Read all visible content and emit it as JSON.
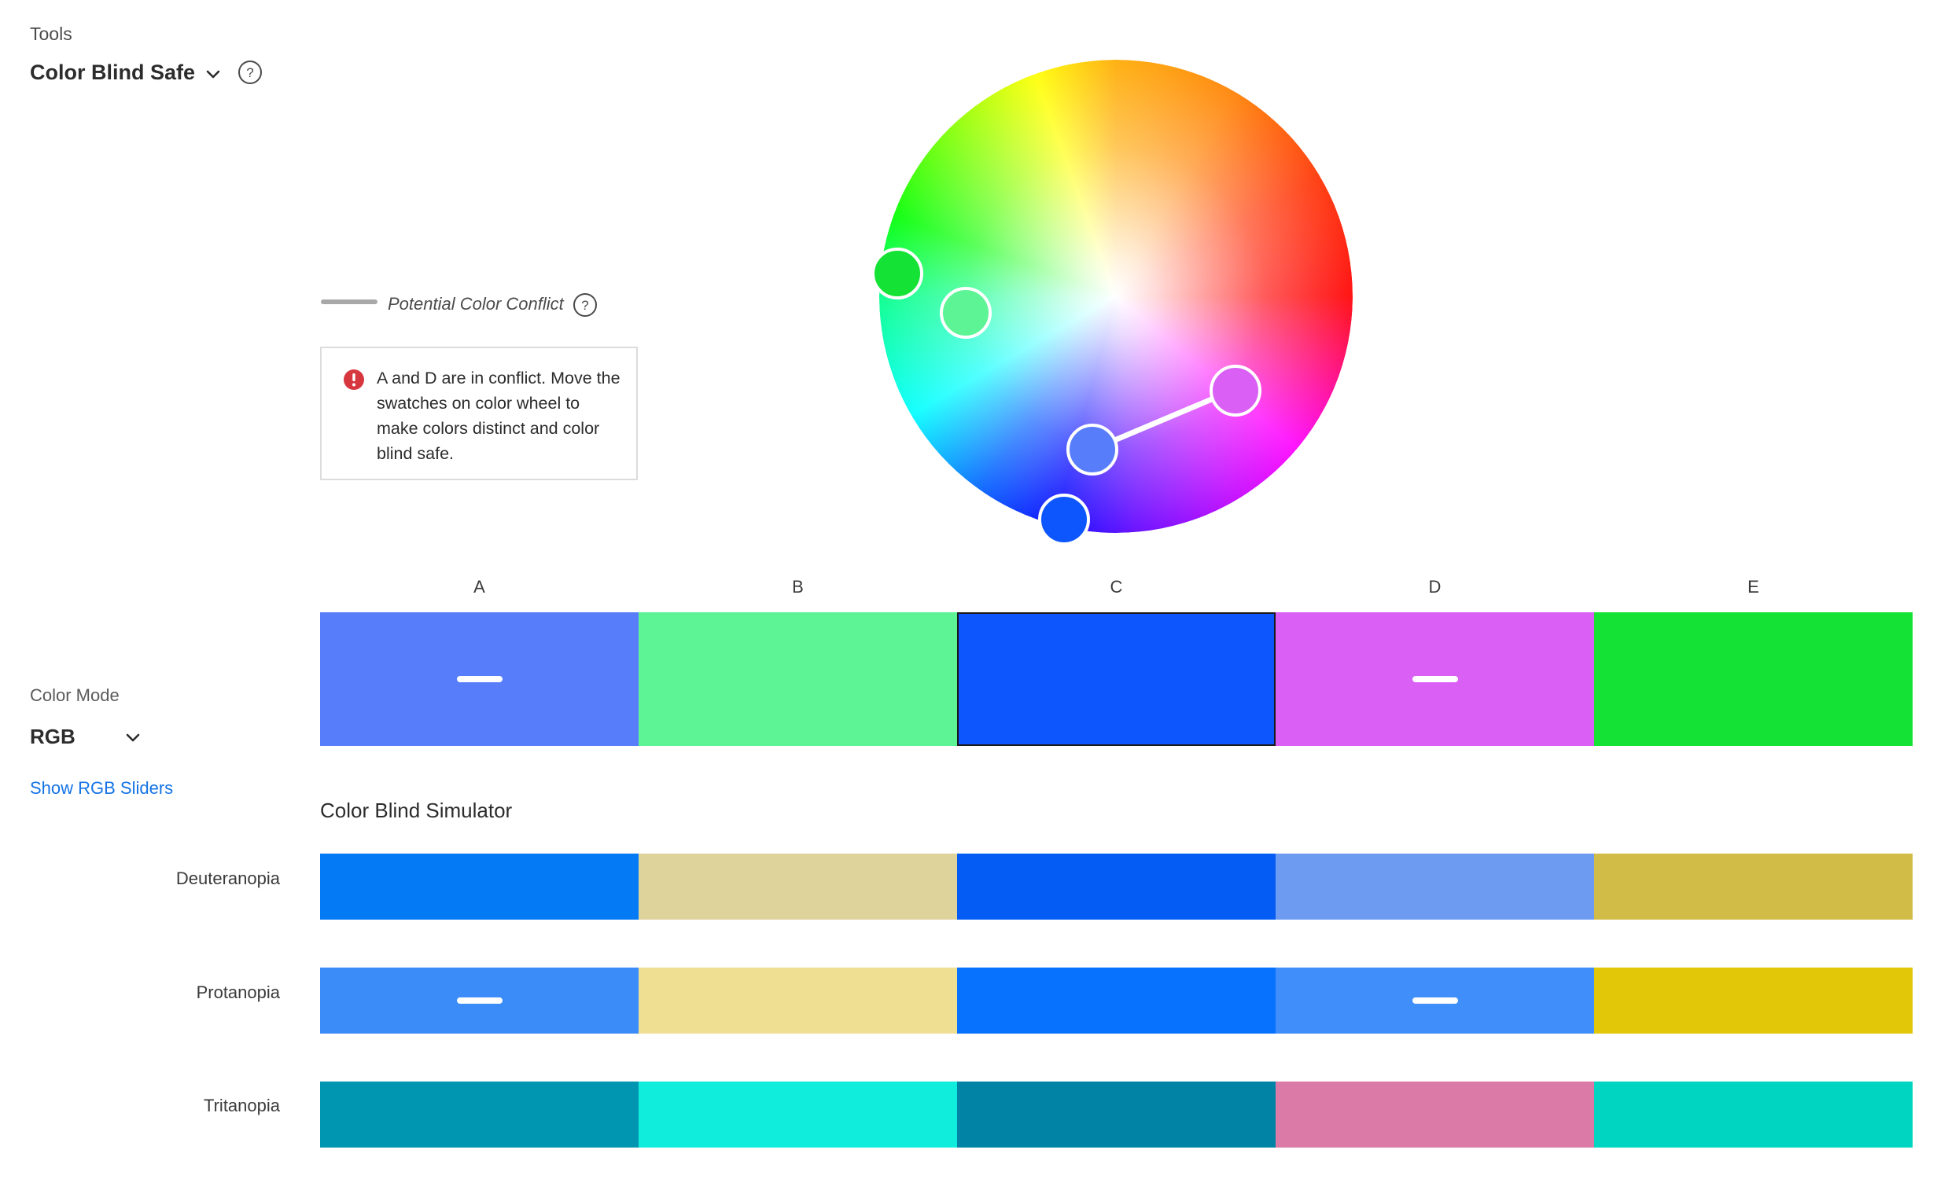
{
  "tool": {
    "section_label": "Tools",
    "title": "Color Blind Safe",
    "chevron_icon": "chevron-down-icon",
    "help_icon": "help-circle-icon"
  },
  "color_mode": {
    "label": "Color Mode",
    "value": "RGB",
    "chevron_icon": "chevron-down-icon",
    "sliders_link": "Show RGB Sliders"
  },
  "conflict_legend": {
    "text": "Potential Color Conflict",
    "help_icon": "help-circle-icon"
  },
  "warning": {
    "icon": "error-icon",
    "icon_color": "#d7373f",
    "text": "A and D are in conflict. Move the swatches on color wheel to make colors distinct and color blind safe."
  },
  "swatches": [
    {
      "label": "A",
      "color": "#587dfa",
      "conflict": true,
      "selected": false
    },
    {
      "label": "B",
      "color": "#5cf495",
      "conflict": false,
      "selected": false
    },
    {
      "label": "C",
      "color": "#0d55fc",
      "conflict": false,
      "selected": true
    },
    {
      "label": "D",
      "color": "#d95ff5",
      "conflict": true,
      "selected": false
    },
    {
      "label": "E",
      "color": "#14e234",
      "conflict": false,
      "selected": false
    }
  ],
  "simulator": {
    "title": "Color Blind Simulator",
    "rows": [
      {
        "name": "Deuteranopia",
        "colors": [
          "#047af5",
          "#dfd39c",
          "#045cf5",
          "#6e9bf2",
          "#d1bc48"
        ],
        "conflict": [
          false,
          false,
          false,
          false,
          false
        ]
      },
      {
        "name": "Protanopia",
        "colors": [
          "#3b8cf9",
          "#efdf92",
          "#0672fd",
          "#3f8ef9",
          "#e1c707"
        ],
        "conflict": [
          true,
          false,
          false,
          true,
          false
        ]
      },
      {
        "name": "Tritanopia",
        "colors": [
          "#0096b2",
          "#10eddd",
          "#0083a5",
          "#dc7aa7",
          "#00d5c1"
        ],
        "conflict": [
          false,
          false,
          false,
          false,
          false
        ]
      }
    ]
  },
  "wheel_handles": [
    {
      "swatch": "E",
      "color": "#14e234",
      "base": false
    },
    {
      "swatch": "B",
      "color": "#5cf495",
      "base": false
    },
    {
      "swatch": "D",
      "color": "#d95ff5",
      "base": false
    },
    {
      "swatch": "A",
      "color": "#587dfa",
      "base": false
    },
    {
      "swatch": "C",
      "color": "#0d55fc",
      "base": true
    }
  ]
}
